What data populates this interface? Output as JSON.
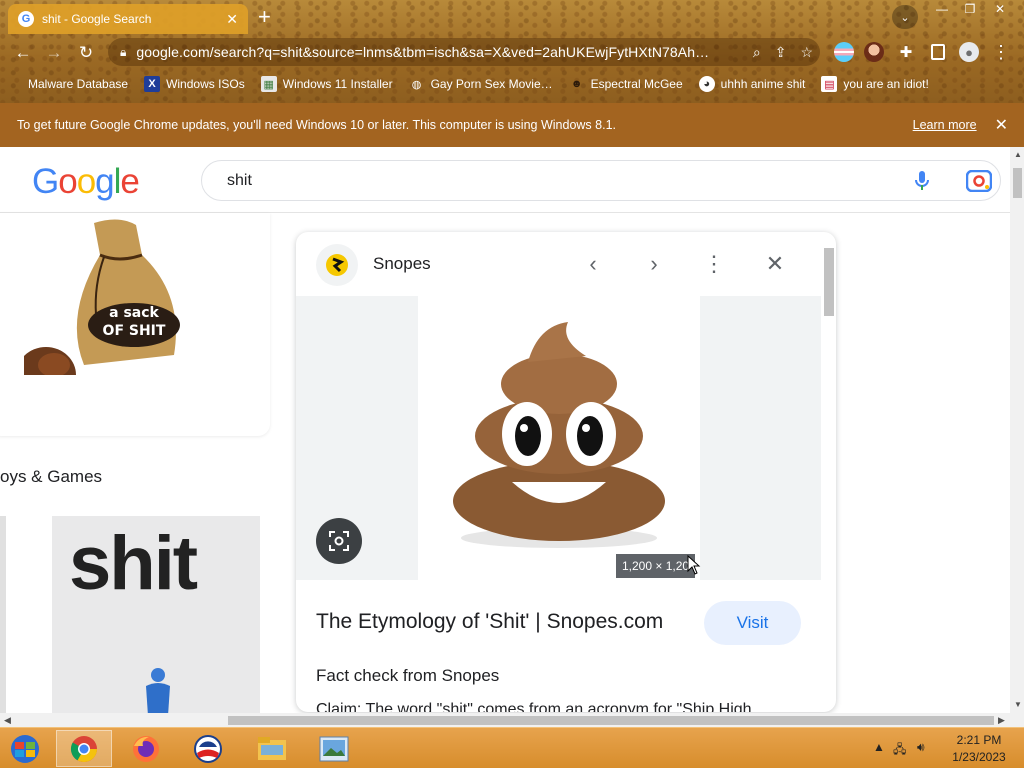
{
  "browser": {
    "tab_title": "shit - Google Search",
    "tab_favicon": "G",
    "tab_close": "✕",
    "new_tab": "+",
    "url": "google.com/search?q=shit&source=lnms&tbm=isch&sa=X&ved=2ahUKEwjFytHXtN78Ah…",
    "bookmarks": [
      {
        "label": "Malware Database",
        "icon": ""
      },
      {
        "label": "Windows ISOs",
        "icon": "X"
      },
      {
        "label": "Windows 11 Installer",
        "icon": "▦"
      },
      {
        "label": "Gay Porn Sex Movie…",
        "icon": "◍"
      },
      {
        "label": "Espectral McGee",
        "icon": "☻"
      },
      {
        "label": "uhhh anime shit",
        "icon": "◕"
      },
      {
        "label": "you are an idiot!",
        "icon": "▤"
      }
    ]
  },
  "infobar": {
    "message": "To get future Google Chrome updates, you'll need Windows 10 or later. This computer is using Windows 8.1.",
    "learn_more": "Learn more",
    "close": "✕"
  },
  "google": {
    "logo_letters": [
      "G",
      "o",
      "o",
      "g",
      "l",
      "e"
    ],
    "query": "shit",
    "category_label": "oys & Games",
    "thumb_word": "shit",
    "bag_text_1": "a sack",
    "bag_text_2": "OF SHIT"
  },
  "preview": {
    "site_name": "Snopes",
    "image_size": "1,200 × 1,20",
    "title": "The Etymology of 'Shit' | Snopes.com",
    "visit_label": "Visit",
    "fact_check": "Fact check from Snopes",
    "claim": "Claim: The word \"shit\" comes from an acronym for \"Ship High"
  },
  "taskbar": {
    "time": "2:21 PM",
    "date": "1/23/2023"
  },
  "colors": {
    "infobar": "#a36420",
    "google_blue": "#4285f4",
    "google_red": "#ea4335",
    "google_yellow": "#fbbc05",
    "google_green": "#34a853",
    "visit_bg": "#e8f0fe",
    "visit_text": "#1a73e8"
  }
}
